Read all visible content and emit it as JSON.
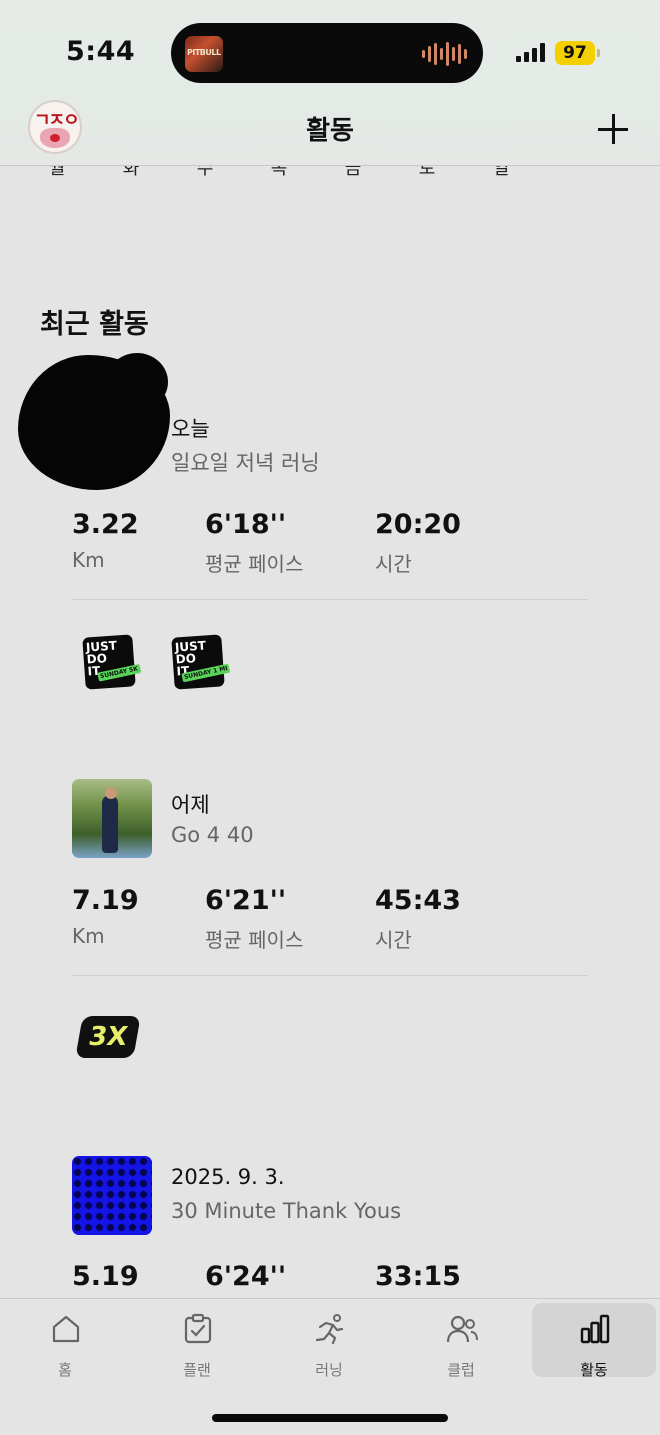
{
  "status_bar": {
    "time": "5:44",
    "album_label": "PITBULL",
    "battery": "97"
  },
  "header": {
    "title": "활동"
  },
  "weekdays": [
    "월",
    "화",
    "수",
    "목",
    "금",
    "토",
    "일"
  ],
  "section_title": "최근 활동",
  "activities": [
    {
      "date": "오늘",
      "name": "일요일 저녁 러닝",
      "distance": "3.22",
      "distance_unit": "Km",
      "pace": "6'18''",
      "pace_label": "평균 페이스",
      "duration": "20:20",
      "duration_label": "시간",
      "badges": [
        {
          "line1": "JUST",
          "line2": "DO",
          "line3": "IT.",
          "tag": "SUNDAY 5K"
        },
        {
          "line1": "JUST",
          "line2": "DO",
          "line3": "IT.",
          "tag": "SUNDAY 1 MI"
        }
      ]
    },
    {
      "date": "어제",
      "name": "Go 4 40",
      "distance": "7.19",
      "distance_unit": "Km",
      "pace": "6'21''",
      "pace_label": "평균 페이스",
      "duration": "45:43",
      "duration_label": "시간",
      "badges": [
        {
          "label": "3X"
        }
      ]
    },
    {
      "date": "2025. 9. 3.",
      "name": "30 Minute Thank Yous",
      "distance": "5.19",
      "pace": "6'24''",
      "duration": "33:15"
    }
  ],
  "tabs": [
    {
      "label": "홈",
      "icon": "home-icon"
    },
    {
      "label": "플랜",
      "icon": "plan-icon"
    },
    {
      "label": "러닝",
      "icon": "running-icon"
    },
    {
      "label": "클럽",
      "icon": "club-icon"
    },
    {
      "label": "활동",
      "icon": "activity-chart-icon",
      "active": true
    }
  ],
  "colors": {
    "background": "#e4e4e4",
    "battery": "#f5d000",
    "active_tab_bg": "#d4d4d4",
    "secondary_text": "#666666"
  }
}
